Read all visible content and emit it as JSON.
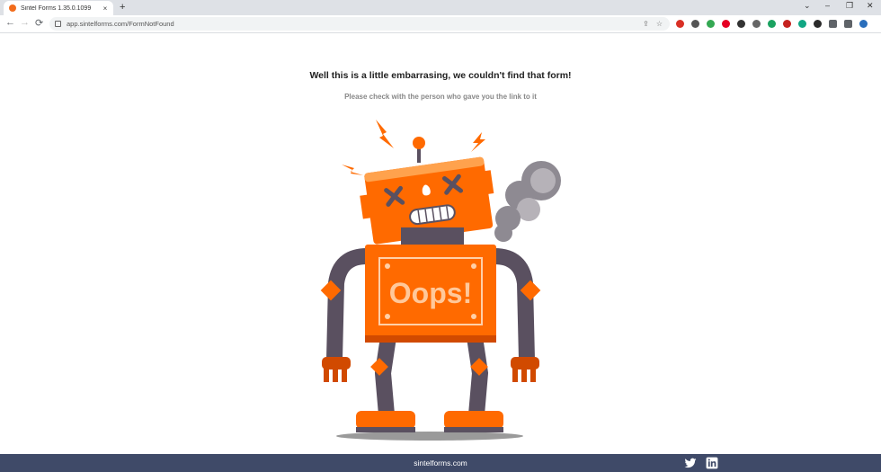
{
  "browser": {
    "tab_title": "Sintel Forms 1.35.0.1099",
    "tab_close": "×",
    "new_tab": "+",
    "url": "app.sintelforms.com/FormNotFound",
    "window_controls": [
      "⌄",
      "–",
      "❐",
      "✕"
    ],
    "nav": {
      "back": "←",
      "forward": "→",
      "reload": "⟳"
    },
    "omnibox_icons": [
      "share-icon",
      "star-icon"
    ],
    "extensions": [
      {
        "name": "ext-1-icon",
        "color": "#d93025"
      },
      {
        "name": "ext-2-icon",
        "color": "#555555"
      },
      {
        "name": "ext-3-icon",
        "color": "#34a853"
      },
      {
        "name": "pinterest-icon",
        "color": "#e60023"
      },
      {
        "name": "ext-5-icon",
        "color": "#333333"
      },
      {
        "name": "ext-6-icon",
        "color": "#666666"
      },
      {
        "name": "ext-7-icon",
        "color": "#1aa260"
      },
      {
        "name": "ext-8-icon",
        "color": "#c5221f"
      },
      {
        "name": "ext-9-icon",
        "color": "#11a683"
      },
      {
        "name": "ext-10-icon",
        "color": "#2b2b2b"
      },
      {
        "name": "puzzle-icon",
        "color": "#5f6368"
      },
      {
        "name": "sidebar-icon",
        "color": "#5f6368"
      },
      {
        "name": "profile-avatar",
        "color": "#2a6ebb"
      }
    ]
  },
  "page": {
    "heading": "Well this is a little embarrasing, we couldn't find that form!",
    "subheading": "Please check with the person who gave you the link to it",
    "robot_sign": "Oops!"
  },
  "footer": {
    "link": "sintelforms.com",
    "social": [
      "twitter-icon",
      "linkedin-icon"
    ]
  },
  "colors": {
    "accent": "#ff6a00",
    "robot_dark": "#5a5060",
    "footer": "#3f4a68"
  }
}
